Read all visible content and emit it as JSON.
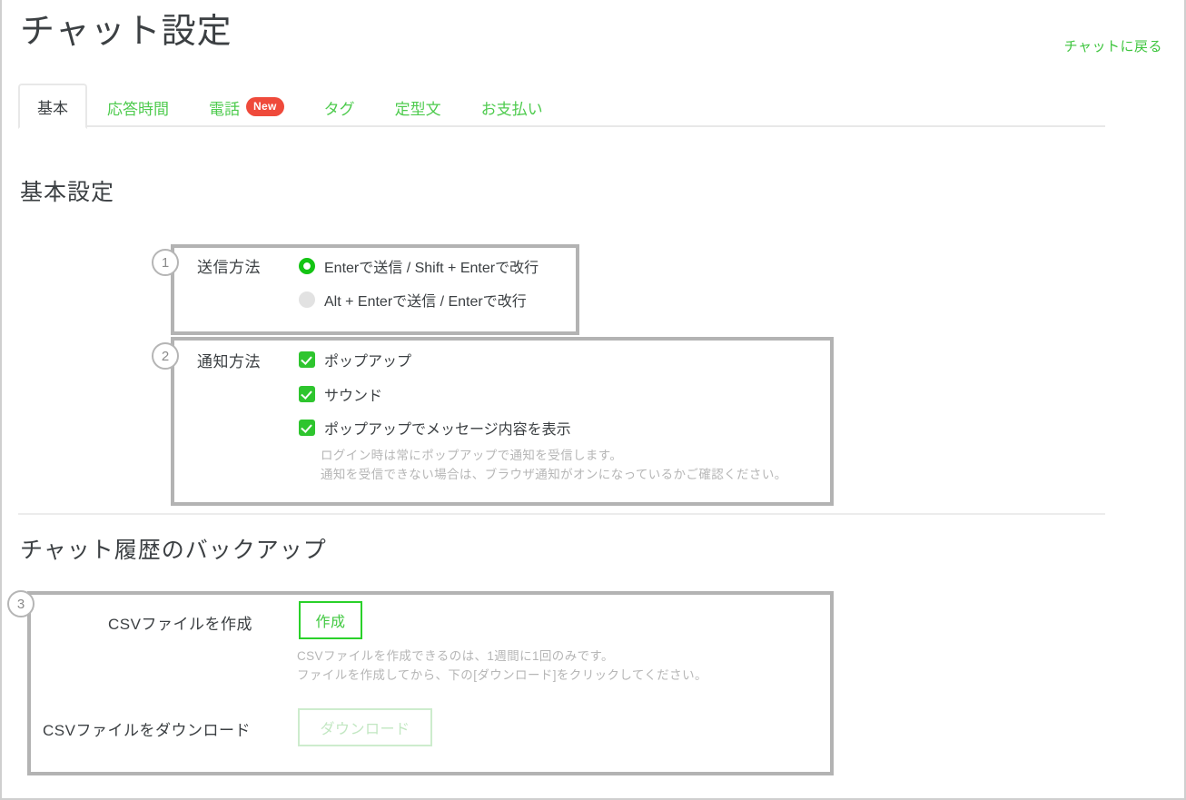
{
  "header": {
    "title": "チャット設定",
    "back_link": "チャットに戻る"
  },
  "tabs": [
    {
      "label": "基本",
      "active": true,
      "badge": ""
    },
    {
      "label": "応答時間",
      "active": false,
      "badge": ""
    },
    {
      "label": "電話",
      "active": false,
      "badge": "New"
    },
    {
      "label": "タグ",
      "active": false,
      "badge": ""
    },
    {
      "label": "定型文",
      "active": false,
      "badge": ""
    },
    {
      "label": "お支払い",
      "active": false,
      "badge": ""
    }
  ],
  "sections": {
    "basic": {
      "heading": "基本設定",
      "send_method": {
        "marker": "1",
        "label": "送信方法",
        "options": [
          {
            "text": "Enterで送信 / Shift + Enterで改行",
            "selected": true
          },
          {
            "text": "Alt + Enterで送信 / Enterで改行",
            "selected": false
          }
        ]
      },
      "notification": {
        "marker": "2",
        "label": "通知方法",
        "options": [
          {
            "text": "ポップアップ",
            "checked": true
          },
          {
            "text": "サウンド",
            "checked": true
          },
          {
            "text": "ポップアップでメッセージ内容を表示",
            "checked": true
          }
        ],
        "help_line_1": "ログイン時は常にポップアップで通知を受信します。",
        "help_line_2": "通知を受信できない場合は、ブラウザ通知がオンになっているかご確認ください。"
      }
    },
    "backup": {
      "heading": "チャット履歴のバックアップ",
      "marker": "3",
      "create_row": {
        "label": "CSVファイルを作成",
        "button_label": "作成"
      },
      "help_line_1": "CSVファイルを作成できるのは、1週間に1回のみです。",
      "help_line_2": "ファイルを作成してから、下の[ダウンロード]をクリックしてください。",
      "download_row": {
        "label": "CSVファイルをダウンロード",
        "button_label": "ダウンロード",
        "disabled": true
      }
    }
  },
  "colors": {
    "accent_green": "#4ecb4e",
    "checkbox_green": "#2ec52e",
    "radio_green": "#14c414",
    "badge_red": "#ef4a3b",
    "text_dark": "#3c4043",
    "help_gray": "#b6b6b6",
    "highlight_box": "#b3b3b3"
  }
}
